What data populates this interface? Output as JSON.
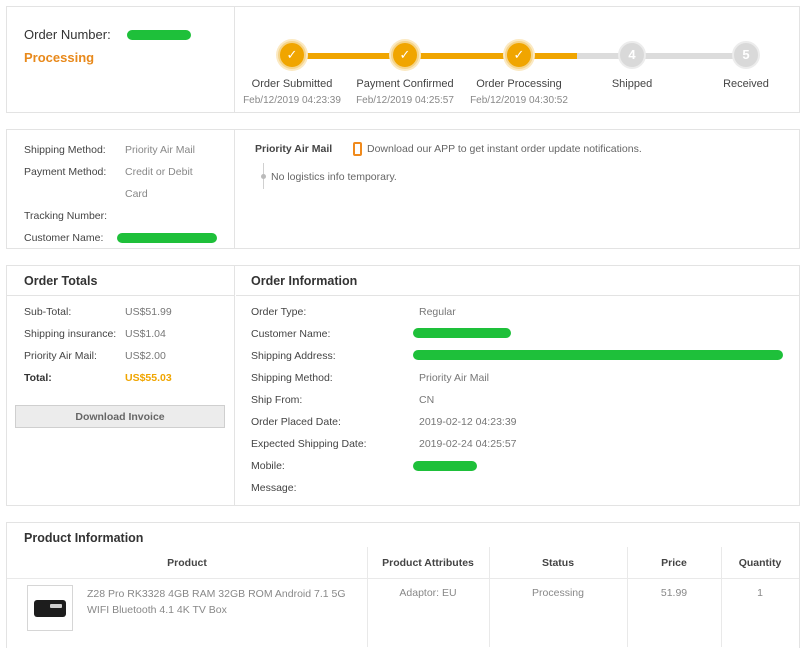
{
  "status": {
    "order_number_label": "Order Number:",
    "state": "Processing",
    "steps": [
      {
        "num": "✓",
        "label": "Order Submitted",
        "date": "Feb/12/2019 04:23:39"
      },
      {
        "num": "✓",
        "label": "Payment Confirmed",
        "date": "Feb/12/2019 04:25:57"
      },
      {
        "num": "✓",
        "label": "Order Processing",
        "date": "Feb/12/2019 04:30:52"
      },
      {
        "num": "4",
        "label": "Shipped",
        "date": ""
      },
      {
        "num": "5",
        "label": "Received",
        "date": ""
      }
    ],
    "completed_steps": 3,
    "colors": {
      "accent": "#f0a500",
      "pending": "#d9d9d9",
      "redaction": "#1ec03a"
    }
  },
  "shipping": {
    "method_label": "Shipping Method:",
    "method_value": "Priority Air Mail",
    "payment_label": "Payment Method:",
    "payment_value_line1": "Credit or Debit",
    "payment_value_line2": "Card",
    "tracking_label": "Tracking Number:",
    "customer_label": "Customer Name:",
    "carrier": "Priority Air Mail",
    "app_note": "Download our APP to get instant order update notifications.",
    "logistics_note": "No logistics info temporary."
  },
  "totals": {
    "title": "Order Totals",
    "rows": [
      {
        "label": "Sub-Total:",
        "value": "US$51.99"
      },
      {
        "label": "Shipping insurance:",
        "value": "US$1.04"
      },
      {
        "label": "Priority Air Mail:",
        "value": "US$2.00"
      },
      {
        "label": "Total:",
        "value": "US$55.03"
      }
    ],
    "invoice_button": "Download Invoice"
  },
  "order_info": {
    "title": "Order Information",
    "rows": [
      {
        "label": "Order Type:",
        "value": "Regular"
      },
      {
        "label": "Customer Name:",
        "value": ""
      },
      {
        "label": "Shipping Address:",
        "value": ""
      },
      {
        "label": "Shipping Method:",
        "value": "Priority Air Mail"
      },
      {
        "label": "Ship From:",
        "value": "CN"
      },
      {
        "label": "Order Placed Date:",
        "value": "2019-02-12 04:23:39"
      },
      {
        "label": "Expected Shipping Date:",
        "value": "2019-02-24 04:25:57"
      },
      {
        "label": "Mobile:",
        "value": ""
      },
      {
        "label": "Message:",
        "value": ""
      }
    ]
  },
  "product": {
    "title": "Product Information",
    "columns": [
      "Product",
      "Product Attributes",
      "Status",
      "Price",
      "Quantity"
    ],
    "items": [
      {
        "name": "Z28 Pro RK3328 4GB RAM 32GB ROM Android 7.1 5G WIFI Bluetooth 4.1 4K TV Box",
        "attributes": "Adaptor: EU",
        "status": "Processing",
        "price": "51.99",
        "quantity": "1"
      }
    ]
  }
}
